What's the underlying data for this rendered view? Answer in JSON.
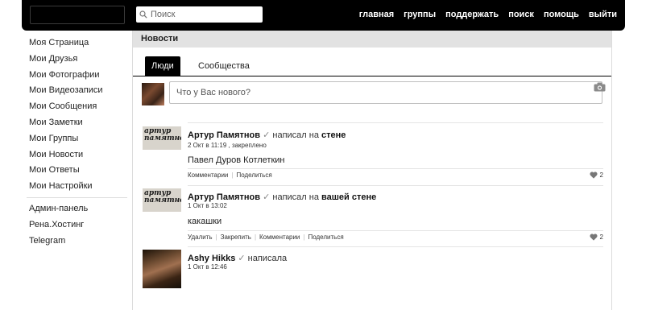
{
  "header": {
    "search_placeholder": "Поиск",
    "nav": [
      "главная",
      "группы",
      "поддержать",
      "поиск",
      "помощь",
      "выйти"
    ]
  },
  "sidebar": {
    "items": [
      "Моя Страница",
      "Мои Друзья",
      "Мои Фотографии",
      "Мои Видеозаписи",
      "Мои Сообщения",
      "Мои Заметки",
      "Мои Группы",
      "Мои Новости",
      "Мои Ответы",
      "Мои Настройки"
    ],
    "extra": [
      "Админ-панель",
      "Рена.Хостинг",
      "Telegram"
    ]
  },
  "main": {
    "title": "Новости",
    "tabs": [
      "Люди",
      "Сообщества"
    ],
    "composer_placeholder": "Что у Вас нового?"
  },
  "posts": [
    {
      "avatar_text": "артур памятнов",
      "author": "Артур Памятнов",
      "verb": "написал на",
      "target": "стене",
      "meta": "2 Окт в 11:19 , закреплено",
      "body": "Павел Дуров Котлеткин",
      "actions": [
        "Комментарии",
        "Поделиться"
      ],
      "likes": "2"
    },
    {
      "avatar_text": "артур памятнов",
      "author": "Артур Памятнов",
      "verb": "написал на",
      "target": "вашей стене",
      "meta": "1 Окт в 13:02",
      "body": "какашки",
      "actions": [
        "Удалить",
        "Закрепить",
        "Комментарии",
        "Поделиться"
      ],
      "likes": "2"
    },
    {
      "author": "Ashy Hikks",
      "verb": "написала",
      "meta": "1 Окт в 12:46"
    }
  ],
  "colors": {
    "header_bg": "#000000",
    "title_bar": "#e2e2e2",
    "border": "#dcdcdc"
  }
}
